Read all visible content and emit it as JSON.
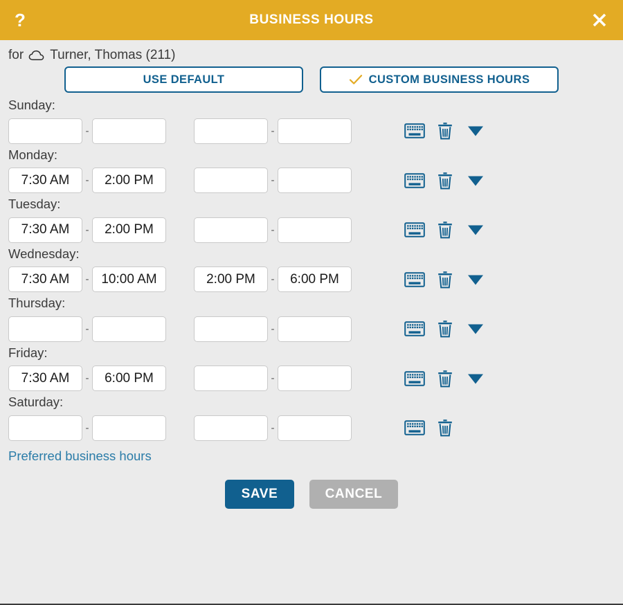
{
  "titlebar": {
    "help_label": "?",
    "title": "BUSINESS HOURS",
    "close_label": "✕",
    "bg_color": "#e3ab24",
    "help_icon": "question-mark-icon",
    "close_icon": "close-icon"
  },
  "subject": {
    "prefix": "for",
    "icon": "cloud-icon",
    "name": "Turner, Thomas (211)"
  },
  "mode": {
    "use_default_label": "USE DEFAULT",
    "custom_label": "CUSTOM BUSINESS HOURS",
    "selected": "custom",
    "check_icon": "check-icon",
    "accent_color": "#11608f",
    "check_color": "#e3ab24"
  },
  "rows": [
    {
      "day": "Sunday:",
      "start1": "",
      "end1": "",
      "start2": "",
      "end2": "",
      "has_chevron": true
    },
    {
      "day": "Monday:",
      "start1": "7:30 AM",
      "end1": "2:00 PM",
      "start2": "",
      "end2": "",
      "has_chevron": true
    },
    {
      "day": "Tuesday:",
      "start1": "7:30 AM",
      "end1": "2:00 PM",
      "start2": "",
      "end2": "",
      "has_chevron": true
    },
    {
      "day": "Wednesday:",
      "start1": "7:30 AM",
      "end1": "10:00 AM",
      "start2": "2:00 PM",
      "end2": "6:00 PM",
      "has_chevron": true
    },
    {
      "day": "Thursday:",
      "start1": "",
      "end1": "",
      "start2": "",
      "end2": "",
      "has_chevron": true
    },
    {
      "day": "Friday:",
      "start1": "7:30 AM",
      "end1": "6:00 PM",
      "start2": "",
      "end2": "",
      "has_chevron": true
    },
    {
      "day": "Saturday:",
      "start1": "",
      "end1": "",
      "start2": "",
      "end2": "",
      "has_chevron": false
    }
  ],
  "row_icons": {
    "keyboard": "keyboard-icon",
    "delete": "trash-icon",
    "expand": "chevron-down-icon",
    "icon_color": "#11608f"
  },
  "separator": "-",
  "preferred_link": {
    "label": "Preferred business hours",
    "color": "#2b7ca8"
  },
  "footer": {
    "save_label": "SAVE",
    "cancel_label": "CANCEL",
    "save_color": "#11608f",
    "cancel_color": "#b0b0b0"
  }
}
